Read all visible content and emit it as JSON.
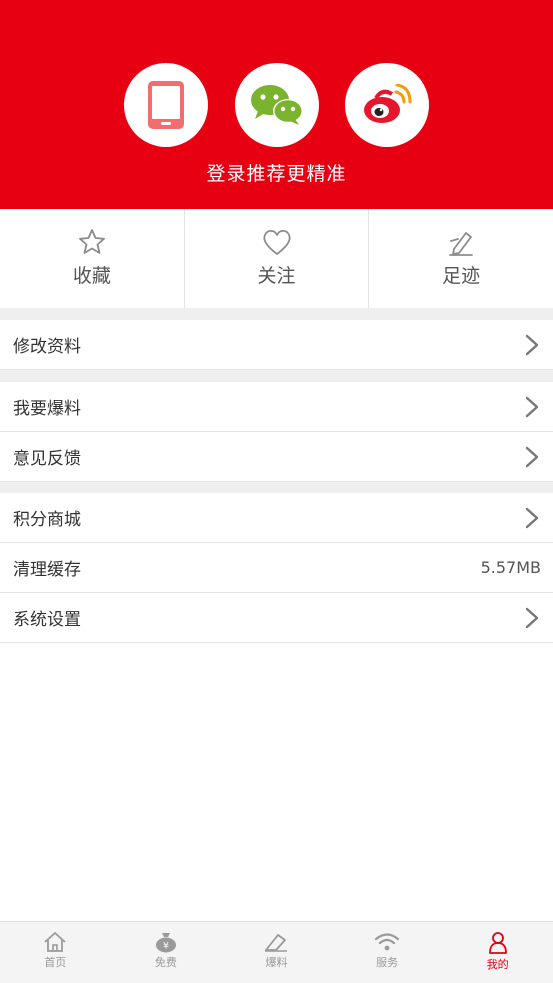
{
  "header": {
    "login_hint": "登录推荐更精准",
    "login_buttons": [
      {
        "icon": "phone-icon"
      },
      {
        "icon": "wechat-icon"
      },
      {
        "icon": "weibo-icon"
      }
    ]
  },
  "quick": [
    {
      "label": "收藏",
      "icon": "star-icon"
    },
    {
      "label": "关注",
      "icon": "heart-icon"
    },
    {
      "label": "足迹",
      "icon": "pen-icon"
    }
  ],
  "menu": {
    "edit_profile": "修改资料",
    "submit_tip": "我要爆料",
    "feedback": "意见反馈",
    "points_mall": "积分商城",
    "clear_cache": "清理缓存",
    "cache_size": "5.57MB",
    "settings": "系统设置"
  },
  "tabs": [
    {
      "label": "首页",
      "icon": "home-icon"
    },
    {
      "label": "免费",
      "icon": "money-bag-icon"
    },
    {
      "label": "爆料",
      "icon": "eraser-icon"
    },
    {
      "label": "服务",
      "icon": "wifi-icon"
    },
    {
      "label": "我的",
      "icon": "user-icon",
      "active": true
    }
  ],
  "colors": {
    "brand": "#e60012",
    "icon_gray": "#8c8c8c",
    "background": "#efefef"
  }
}
